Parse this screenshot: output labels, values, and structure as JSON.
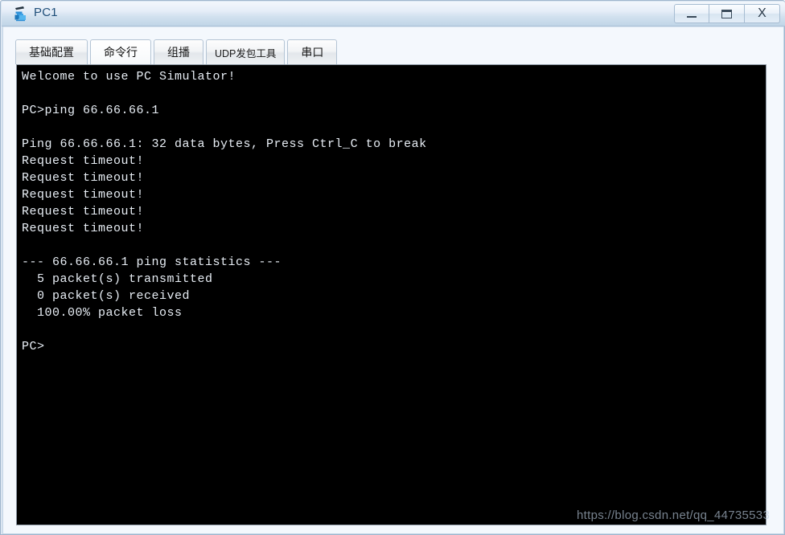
{
  "window": {
    "title": "PC1",
    "icon": "pc-simulator-icon",
    "controls": [
      {
        "name": "minimize-button",
        "glyph": "—"
      },
      {
        "name": "maximize-button",
        "glyph": "☐"
      },
      {
        "name": "close-button",
        "glyph": "X"
      }
    ]
  },
  "tabs": [
    {
      "label": "基础配置",
      "active": false
    },
    {
      "label": "命令行",
      "active": true
    },
    {
      "label": "组播",
      "active": false
    },
    {
      "label": "UDP发包工具",
      "active": false
    },
    {
      "label": "串口",
      "active": false
    }
  ],
  "terminal": {
    "prompt": "PC>",
    "command": "ping 66.66.66.1",
    "target_ip": "66.66.66.1",
    "packet_size_bytes": 32,
    "transmitted": 5,
    "received": 0,
    "packet_loss": "100.00%",
    "timeout_count": 5,
    "lines": [
      "Welcome to use PC Simulator!",
      "",
      "PC>ping 66.66.66.1",
      "",
      "Ping 66.66.66.1: 32 data bytes, Press Ctrl_C to break",
      "Request timeout!",
      "Request timeout!",
      "Request timeout!",
      "Request timeout!",
      "Request timeout!",
      "",
      "--- 66.66.66.1 ping statistics ---",
      "  5 packet(s) transmitted",
      "  0 packet(s) received",
      "  100.00% packet loss",
      "",
      "PC>"
    ]
  },
  "watermark": {
    "text": "https://blog.csdn.net/qq_44735533"
  },
  "colors": {
    "title_text": "#1f4e79",
    "terminal_bg": "#000000",
    "terminal_fg": "#e8eef5",
    "panel_bg": "#f4f8fd",
    "frame": "#9fb6cd"
  }
}
